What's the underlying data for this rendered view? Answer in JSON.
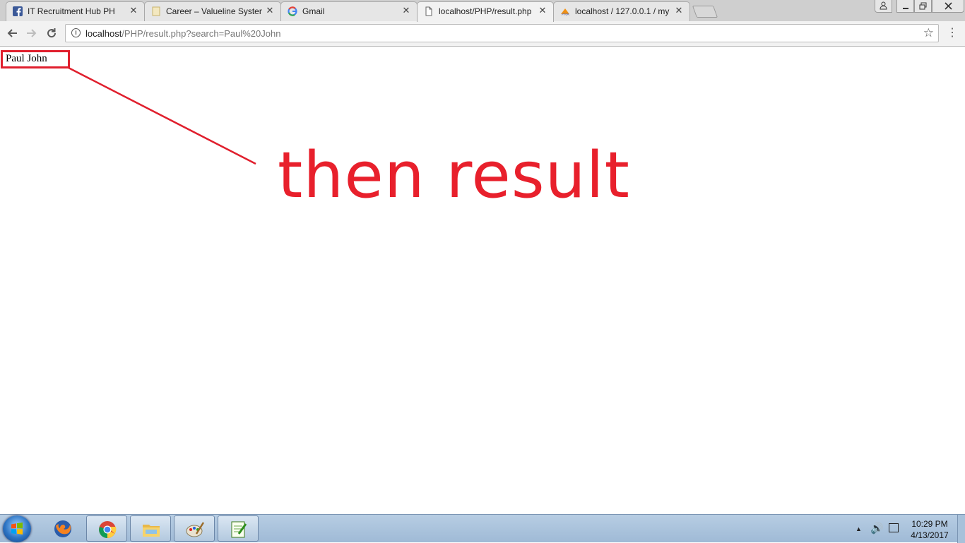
{
  "browser": {
    "tabs": [
      {
        "title": "IT Recruitment Hub PH",
        "icon": "facebook-icon"
      },
      {
        "title": "Career – Valueline System",
        "icon": "page-icon"
      },
      {
        "title": "Gmail",
        "icon": "google-icon"
      },
      {
        "title": "localhost/PHP/result.php",
        "icon": "document-icon",
        "active": true
      },
      {
        "title": "localhost / 127.0.0.1 / my",
        "icon": "phpmyadmin-icon"
      }
    ],
    "close_glyph": "✕",
    "address": {
      "host": "localhost",
      "path": "/PHP/result.php?search=Paul%20John"
    }
  },
  "page": {
    "result_name": "Paul John",
    "annotation": "then result",
    "accent_color": "#e01f2d"
  },
  "taskbar": {
    "apps": [
      "firefox-icon",
      "chrome-icon",
      "file-explorer-icon",
      "paint-icon",
      "notepad-plus-plus-icon"
    ],
    "clock": {
      "time": "10:29 PM",
      "date": "4/13/2017"
    }
  }
}
